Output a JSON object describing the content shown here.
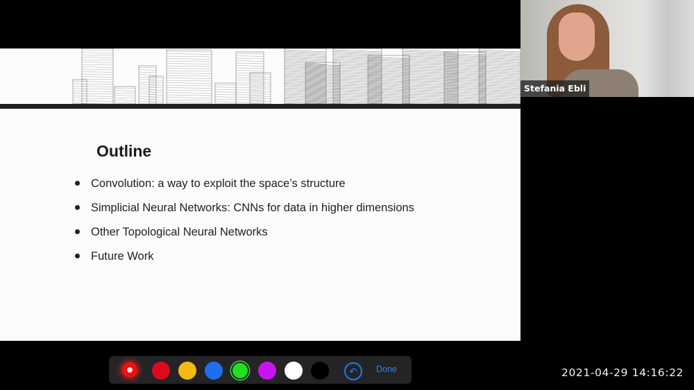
{
  "slide": {
    "title": "Outline",
    "bullets": [
      "Convolution: a way to exploit the space’s structure",
      "Simplicial Neural Networks: CNNs for data in higher dimensions",
      "Other Topological Neural Networks",
      "Future Work"
    ],
    "banner_image": "wireframe-city-skyline"
  },
  "video_tile": {
    "participant_name": "Stefania Ebli"
  },
  "annotation_toolbar": {
    "colors": [
      {
        "name": "laser-red",
        "hex": "#f01010",
        "active": true
      },
      {
        "name": "red",
        "hex": "#dc0a1e"
      },
      {
        "name": "yellow",
        "hex": "#f5b914"
      },
      {
        "name": "blue",
        "hex": "#1e6ef0"
      },
      {
        "name": "green",
        "hex": "#20e020",
        "selected": true
      },
      {
        "name": "purple",
        "hex": "#c814f0"
      },
      {
        "name": "white",
        "hex": "#ffffff"
      },
      {
        "name": "black",
        "hex": "#000000"
      }
    ],
    "undo_icon": "undo-icon",
    "undo_glyph": "↶",
    "done_label": "Done"
  },
  "timestamp": "2021-04-29  14:16:22"
}
